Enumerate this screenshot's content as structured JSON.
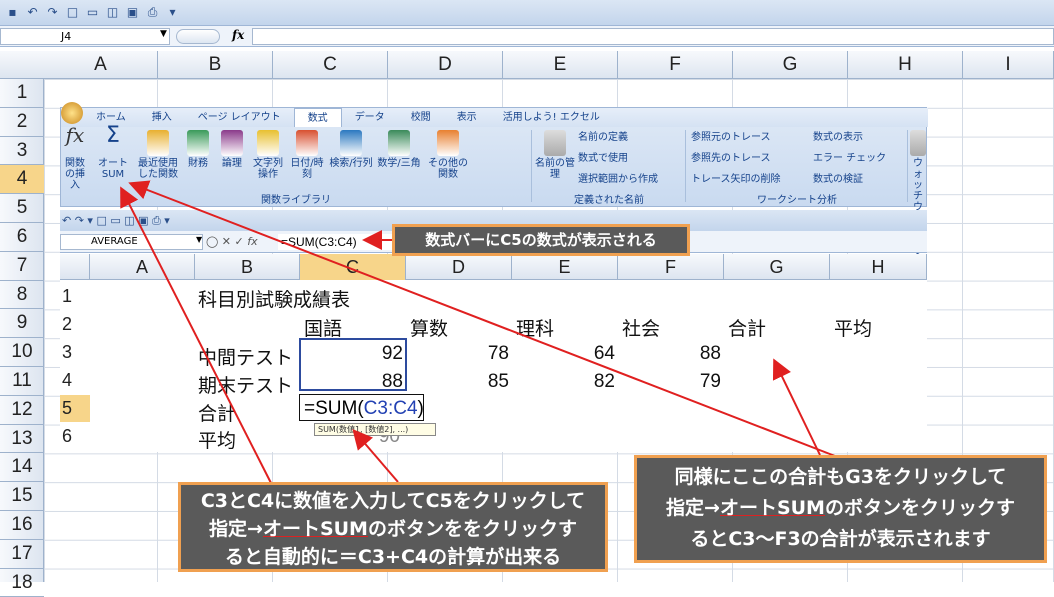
{
  "outer": {
    "name_box": "J4",
    "fx_label": "fx",
    "columns": [
      "A",
      "B",
      "C",
      "D",
      "E",
      "F",
      "G",
      "H",
      "I"
    ],
    "rows": [
      "1",
      "2",
      "3",
      "4",
      "5",
      "6",
      "7",
      "8",
      "9",
      "10",
      "11",
      "12",
      "13",
      "14",
      "15",
      "16",
      "17",
      "18"
    ],
    "selected_row": "4"
  },
  "ribbon": {
    "tabs": [
      "ホーム",
      "挿入",
      "ページ レイアウト",
      "数式",
      "データ",
      "校閲",
      "表示",
      "活用しよう! エクセル"
    ],
    "active_tab": "数式",
    "buttons": [
      {
        "icon": "function-insert-icon",
        "label": "関数の挿入"
      },
      {
        "icon": "autosum-sigma-icon",
        "label": "オート SUM"
      },
      {
        "icon": "recent-functions-icon",
        "label": "最近使用した関数"
      },
      {
        "icon": "financial-icon",
        "label": "財務"
      },
      {
        "icon": "logical-icon",
        "label": "論理"
      },
      {
        "icon": "text-functions-icon",
        "label": "文字列操作"
      },
      {
        "icon": "datetime-icon",
        "label": "日付/時刻"
      },
      {
        "icon": "lookup-icon",
        "label": "検索/行列"
      },
      {
        "icon": "math-trig-icon",
        "label": "数学/三角"
      },
      {
        "icon": "more-functions-icon",
        "label": "その他の関数"
      }
    ],
    "group1": "関数ライブラリ",
    "names_button": "名前の管理",
    "names_items": [
      "名前の定義",
      "数式で使用",
      "選択範囲から作成"
    ],
    "group2": "定義された名前",
    "audit_items": [
      "参照元のトレース",
      "参照先のトレース",
      "トレース矢印の削除"
    ],
    "audit_items2": [
      "数式の表示",
      "エラー チェック",
      "数式の検証"
    ],
    "group3": "ワークシート分析",
    "watch": "ウォッチ ウィンドウ"
  },
  "inner": {
    "name_box": "AVERAGE",
    "formula": "=SUM(C3:C4)",
    "columns": [
      "A",
      "B",
      "C",
      "D",
      "E",
      "F",
      "G",
      "H"
    ],
    "rows": [
      "1",
      "2",
      "3",
      "4",
      "5",
      "6"
    ],
    "title": "科目別試験成績表",
    "headers": [
      "国語",
      "算数",
      "理科",
      "社会",
      "合計",
      "平均"
    ],
    "mid_label": "中間テスト",
    "mid": [
      "92",
      "78",
      "64",
      "88"
    ],
    "end_label": "期末テスト",
    "end": [
      "88",
      "85",
      "82",
      "79"
    ],
    "total_label": "合計",
    "avg_label": "平均",
    "avg_c": "90",
    "edit_prefix": "=SUM(",
    "edit_ref": "C3:C4",
    "edit_suffix": ")",
    "tooltip": "SUM(数値1, [数値2], ...)"
  },
  "callouts": {
    "bar": "数式バーにC5の数式が表示される",
    "left_1": "C3とC4に数値を入力してC5をクリックして",
    "left_2a": "指定→",
    "left_2b": "オートSUM",
    "left_2c": "のボタンををクリックす",
    "left_3": "ると自動的に＝C3+C4の計算が出来る",
    "right_1": "同様にここの合計もG3をクリックして",
    "right_2a": "指定→",
    "right_2b": "オートSUM",
    "right_2c": "のボタンをクリックす",
    "right_3": "るとC3～F3の合計が表示されます"
  },
  "colors": {
    "accent": "#f0a050",
    "callout_bg": "#5a5a5a",
    "arrow": "#e02020",
    "selection": "#2d4b9e"
  }
}
